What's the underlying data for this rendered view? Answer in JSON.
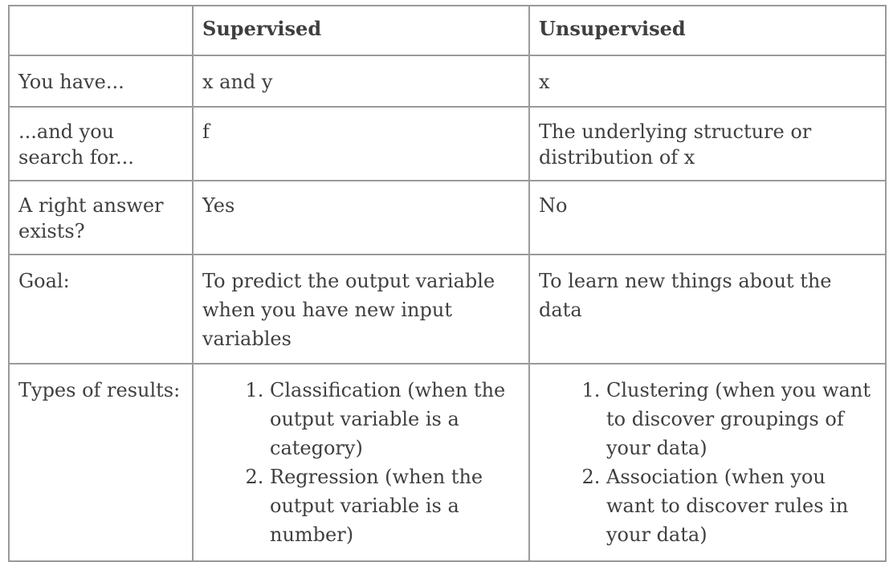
{
  "table": {
    "headers": [
      "",
      "Supervised",
      "Unsupervised"
    ],
    "rows": [
      {
        "label": "You have...",
        "supervised": "x and y",
        "unsupervised": "x"
      },
      {
        "label": "...and you search for...",
        "supervised": "f",
        "unsupervised": "The underlying structure or distribution of x"
      },
      {
        "label": "A right answer exists?",
        "supervised": "Yes",
        "unsupervised": "No"
      },
      {
        "label": "Goal:",
        "supervised": "To predict the output variable when you have new input variables",
        "unsupervised": "To learn new things about the data"
      }
    ],
    "types": {
      "label": "Types of results:",
      "supervised": [
        "Classification (when the output variable is a category)",
        "Regression (when the output variable is a number)"
      ],
      "unsupervised": [
        "Clustering (when you want to discover groupings of your data)",
        "Association (when you want to discover rules in your data)"
      ]
    }
  }
}
